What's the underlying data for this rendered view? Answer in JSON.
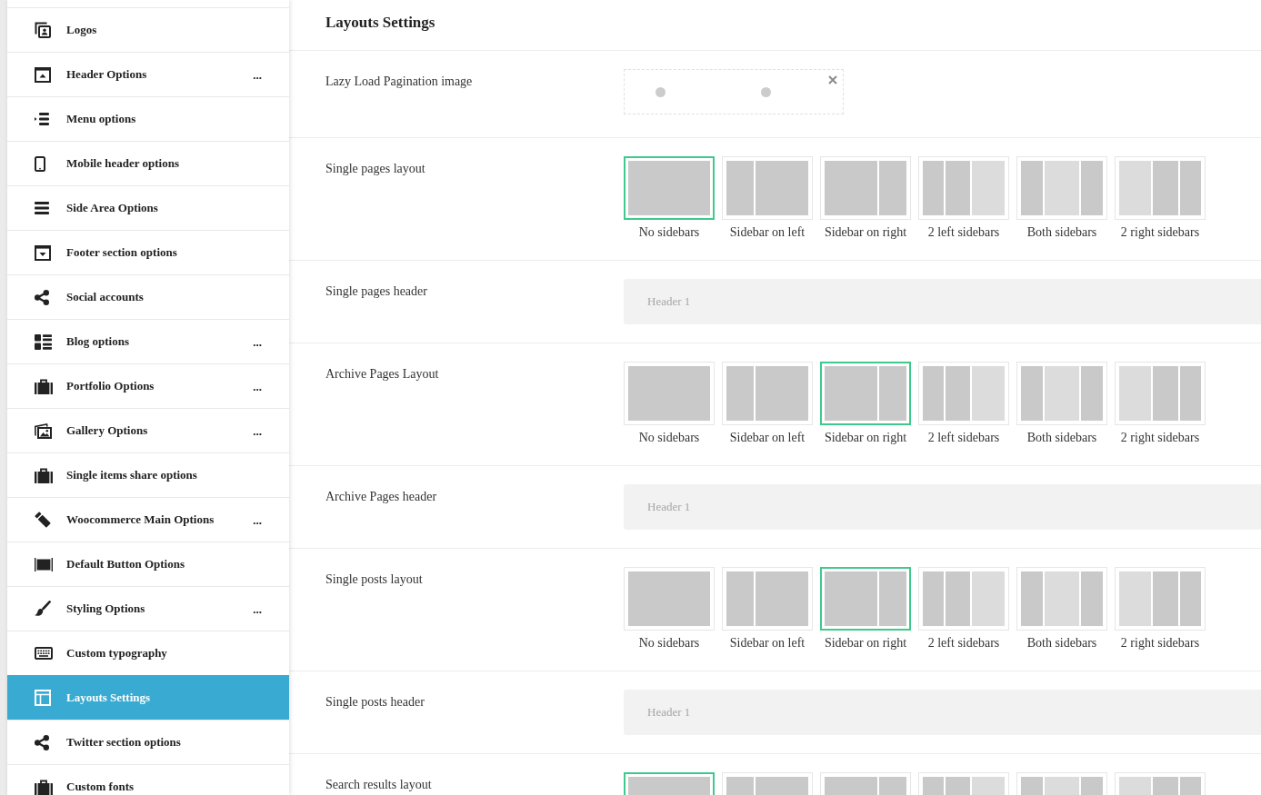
{
  "sidebar": {
    "items": [
      {
        "label": "Logos",
        "selected": false
      },
      {
        "label": "Header Options",
        "more": "...",
        "selected": false
      },
      {
        "label": "Menu options",
        "selected": false
      },
      {
        "label": "Mobile header options",
        "selected": false
      },
      {
        "label": "Side Area Options",
        "selected": false
      },
      {
        "label": "Footer section options",
        "selected": false
      },
      {
        "label": "Social accounts",
        "selected": false
      },
      {
        "label": "Blog options",
        "more": "...",
        "selected": false
      },
      {
        "label": "Portfolio Options",
        "more": "...",
        "selected": false
      },
      {
        "label": "Gallery Options",
        "more": "...",
        "selected": false
      },
      {
        "label": "Single items share options",
        "selected": false
      },
      {
        "label": "Woocommerce Main Options",
        "more": "...",
        "selected": false
      },
      {
        "label": "Default Button Options",
        "selected": false
      },
      {
        "label": "Styling Options",
        "more": "...",
        "selected": false
      },
      {
        "label": "Custom typography",
        "selected": false
      },
      {
        "label": "Layouts Settings",
        "selected": true
      },
      {
        "label": "Twitter section options",
        "selected": false
      },
      {
        "label": "Custom fonts",
        "selected": false
      }
    ]
  },
  "main": {
    "title": "Layouts Settings",
    "sections": [
      {
        "kind": "image",
        "label": "Lazy Load Pagination image"
      },
      {
        "kind": "layout",
        "label": "Single pages layout",
        "options": [
          {
            "kind": "none",
            "label": "No sidebars",
            "selected": true
          },
          {
            "kind": "left",
            "label": "Sidebar on left",
            "selected": false
          },
          {
            "kind": "right",
            "label": "Sidebar on right",
            "selected": false
          },
          {
            "kind": "two-left",
            "label": "2 left sidebars",
            "selected": false
          },
          {
            "kind": "both",
            "label": "Both sidebars",
            "selected": false
          },
          {
            "kind": "two-right",
            "label": "2 right sidebars",
            "selected": false
          }
        ]
      },
      {
        "kind": "select",
        "label": "Single pages header",
        "value": "Header 1"
      },
      {
        "kind": "layout",
        "label": "Archive Pages Layout",
        "options": [
          {
            "kind": "none",
            "label": "No sidebars",
            "selected": false
          },
          {
            "kind": "left",
            "label": "Sidebar on left",
            "selected": false
          },
          {
            "kind": "right",
            "label": "Sidebar on right",
            "selected": true
          },
          {
            "kind": "two-left",
            "label": "2 left sidebars",
            "selected": false
          },
          {
            "kind": "both",
            "label": "Both sidebars",
            "selected": false
          },
          {
            "kind": "two-right",
            "label": "2 right sidebars",
            "selected": false
          }
        ]
      },
      {
        "kind": "select",
        "label": "Archive Pages header",
        "value": "Header 1"
      },
      {
        "kind": "layout",
        "label": "Single posts layout",
        "options": [
          {
            "kind": "none",
            "label": "No sidebars",
            "selected": false
          },
          {
            "kind": "left",
            "label": "Sidebar on left",
            "selected": false
          },
          {
            "kind": "right",
            "label": "Sidebar on right",
            "selected": true
          },
          {
            "kind": "two-left",
            "label": "2 left sidebars",
            "selected": false
          },
          {
            "kind": "both",
            "label": "Both sidebars",
            "selected": false
          },
          {
            "kind": "two-right",
            "label": "2 right sidebars",
            "selected": false
          }
        ]
      },
      {
        "kind": "select",
        "label": "Single posts header",
        "value": "Header 1"
      },
      {
        "kind": "layout",
        "label": "Search results layout",
        "options": [
          {
            "kind": "none",
            "selected": true
          },
          {
            "kind": "left",
            "selected": false
          },
          {
            "kind": "right",
            "selected": false
          },
          {
            "kind": "two-left",
            "selected": false
          },
          {
            "kind": "both",
            "selected": false
          },
          {
            "kind": "two-right",
            "selected": false
          }
        ]
      }
    ]
  }
}
